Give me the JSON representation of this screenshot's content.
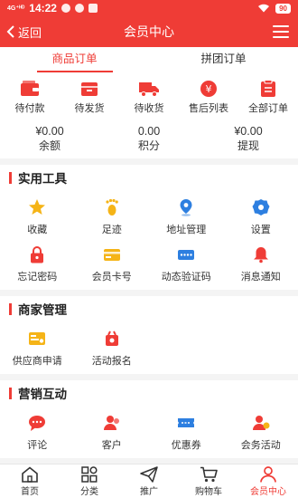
{
  "status_bar": {
    "signal": "4G⁺ᴴᴰ",
    "time": "14:22",
    "battery": "90"
  },
  "header": {
    "back_label": "返回",
    "title": "会员中心"
  },
  "order_tabs": [
    {
      "label": "商品订单",
      "active": true
    },
    {
      "label": "拼团订单",
      "active": false
    }
  ],
  "order_status": [
    {
      "label": "待付款",
      "icon": "wallet-icon"
    },
    {
      "label": "待发货",
      "icon": "box-icon"
    },
    {
      "label": "待收货",
      "icon": "truck-icon"
    },
    {
      "label": "售后列表",
      "icon": "yen-refund-icon"
    },
    {
      "label": "全部订单",
      "icon": "clipboard-icon"
    }
  ],
  "stats": [
    {
      "value": "¥0.00",
      "label": "余额"
    },
    {
      "value": "0.00",
      "label": "积分"
    },
    {
      "value": "¥0.00",
      "label": "提现"
    }
  ],
  "tools": {
    "title": "实用工具",
    "items": [
      {
        "label": "收藏",
        "icon": "star-icon",
        "color": "#f5b417"
      },
      {
        "label": "足迹",
        "icon": "footprint-icon",
        "color": "#f5b417"
      },
      {
        "label": "地址管理",
        "icon": "location-icon",
        "color": "#2d7fe0"
      },
      {
        "label": "设置",
        "icon": "gear-icon",
        "color": "#2d7fe0"
      },
      {
        "label": "忘记密码",
        "icon": "lock-icon",
        "color": "#ef3c36"
      },
      {
        "label": "会员卡号",
        "icon": "card-icon",
        "color": "#f5b417"
      },
      {
        "label": "动态验证码",
        "icon": "code-icon",
        "color": "#2d7fe0"
      },
      {
        "label": "消息通知",
        "icon": "bell-icon",
        "color": "#ef3c36"
      }
    ]
  },
  "merchant": {
    "title": "商家管理",
    "items": [
      {
        "label": "供应商申请",
        "icon": "supplier-card-icon",
        "color": "#f5b417"
      },
      {
        "label": "活动报名",
        "icon": "signup-icon",
        "color": "#ef3c36"
      }
    ]
  },
  "marketing": {
    "title": "营销互动",
    "items": [
      {
        "label": "评论",
        "icon": "chat-icon",
        "color": "#ef3c36"
      },
      {
        "label": "客户",
        "icon": "customers-icon",
        "color": "#ef3c36"
      },
      {
        "label": "优惠券",
        "icon": "coupon-icon",
        "color": "#2d7fe0"
      },
      {
        "label": "会务活动",
        "icon": "meeting-icon",
        "color": "#ef3c36"
      }
    ]
  },
  "bottom_nav": [
    {
      "label": "首页",
      "icon": "home-icon",
      "active": false
    },
    {
      "label": "分类",
      "icon": "category-icon",
      "active": false
    },
    {
      "label": "推广",
      "icon": "paper-plane-icon",
      "active": false
    },
    {
      "label": "购物车",
      "icon": "cart-icon",
      "active": false
    },
    {
      "label": "会员中心",
      "icon": "user-icon",
      "active": true
    }
  ],
  "colors": {
    "accent": "#ef3c36",
    "yellow": "#f5b417",
    "blue": "#2d7fe0"
  }
}
